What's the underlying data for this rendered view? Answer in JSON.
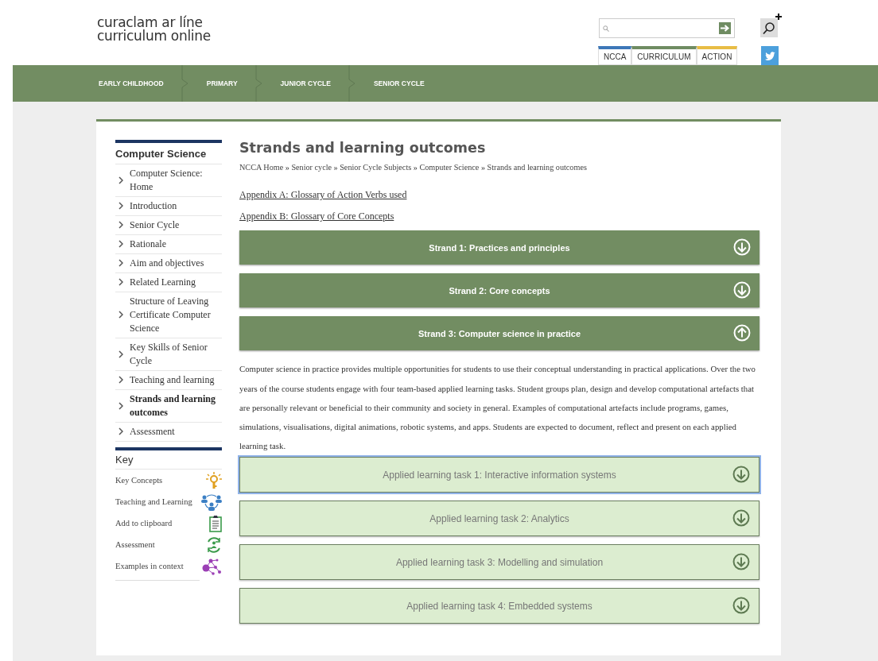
{
  "logo": {
    "line_1": "curaclam ar líne",
    "line_2": "curriculum online"
  },
  "site_tabs": [
    {
      "label": "NCCA",
      "color": "#3d77b8"
    },
    {
      "label": "CURRICULUM",
      "color": "#6f8c62"
    },
    {
      "label": "ACTION",
      "color": "#e8bd45"
    }
  ],
  "nav": [
    "EARLY CHILDHOOD",
    "PRIMARY",
    "JUNIOR CYCLE",
    "SENIOR CYCLE"
  ],
  "sidebar": {
    "title": "Computer Science",
    "items": [
      {
        "label": "Computer Science: Home",
        "selected": false
      },
      {
        "label": "Introduction",
        "selected": false
      },
      {
        "label": "Senior Cycle",
        "selected": false
      },
      {
        "label": "Rationale",
        "selected": false
      },
      {
        "label": "Aim and objectives",
        "selected": false
      },
      {
        "label": "Related Learning",
        "selected": false
      },
      {
        "label": "Structure of Leaving Certificate Computer Science",
        "selected": false
      },
      {
        "label": "Key Skills of Senior Cycle",
        "selected": false
      },
      {
        "label": "Teaching and learning",
        "selected": false
      },
      {
        "label": "Strands and learning outcomes",
        "selected": true
      },
      {
        "label": "Assessment",
        "selected": false
      }
    ]
  },
  "key": {
    "title": "Key",
    "items": [
      {
        "label": "Key Concepts",
        "kind": "bulb"
      },
      {
        "label": "Teaching and Learning",
        "kind": "people"
      },
      {
        "label": "Add to clipboard",
        "kind": "clipboard"
      },
      {
        "label": "Assessment",
        "kind": "cycle"
      },
      {
        "label": "Examples in context",
        "kind": "network"
      }
    ]
  },
  "title": "Strands and learning outcomes",
  "breadcrumb": {
    "links": [
      "NCCA Home",
      "Senior cycle",
      "Senior Cycle Subjects",
      "Computer Science"
    ],
    "separator": "»",
    "current": "Strands and learning outcomes"
  },
  "appendix_links": [
    "Appendix A: Glossary of Action Verbs used",
    "Appendix B: Glossary of Core Concepts"
  ],
  "strands": [
    {
      "label": "Strand 1: Practices and principles",
      "expanded": false
    },
    {
      "label": "Strand 2: Core concepts",
      "expanded": false
    },
    {
      "label": "Strand 3: Computer science in practice",
      "expanded": true
    }
  ],
  "strand_text": "Computer science in practice provides multiple opportunities for students to use their conceptual understanding in practical applications. Over the two years of the course students engage with four team-based applied learning tasks. Student groups plan, design and develop computational artefacts that are personally relevant or beneficial to their community and society in general. Examples of computational artefacts include programs, games, simulations, visualisations, digital animations, robotic systems, and apps. Students are expected to document, reflect and present on each applied learning task.",
  "tasks": [
    {
      "label": "Applied learning task 1: Interactive information systems",
      "expanded": false,
      "focused": true
    },
    {
      "label": "Applied learning task 2: Analytics",
      "expanded": false,
      "focused": false
    },
    {
      "label": "Applied learning task 3: Modelling and simulation",
      "expanded": false,
      "focused": false
    },
    {
      "label": "Applied learning task 4: Embedded systems",
      "expanded": false,
      "focused": false
    }
  ]
}
